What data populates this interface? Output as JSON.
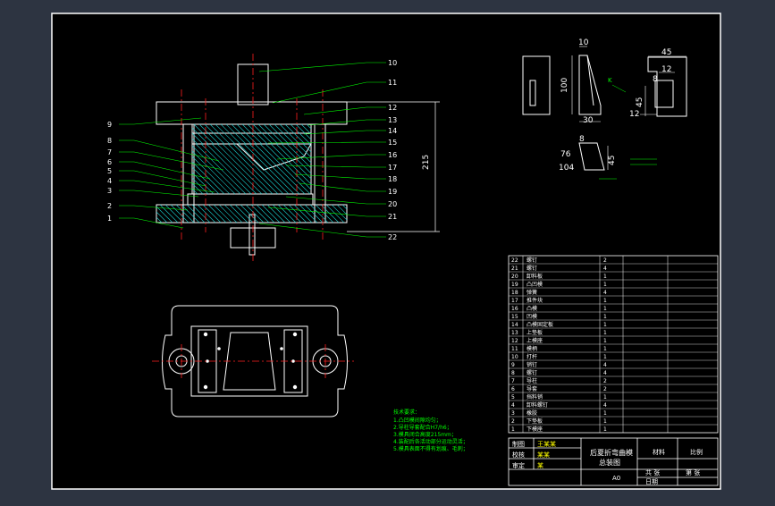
{
  "colors": {
    "background": "#2d3441",
    "drawing_bg": "#000000",
    "line": "#ffffff",
    "callout": "#00ff00",
    "centerline": "#ff2020",
    "hatch": "#19c8c8",
    "dimension": "#ffffff",
    "accent": "#ffff00"
  },
  "callouts": {
    "right": [
      "10",
      "11",
      "12",
      "13",
      "14",
      "15",
      "16",
      "17",
      "18",
      "19",
      "20",
      "21",
      "22"
    ],
    "left": [
      "9",
      "8",
      "7",
      "6",
      "5",
      "4",
      "3",
      "2",
      "1"
    ]
  },
  "dimensions": {
    "total_height": "215",
    "part_width_top": "10",
    "part_height": "100",
    "part_width_bottom": "30",
    "bracket_width": "45",
    "bracket_inner": "12",
    "bracket_bend": "8",
    "bracket_height": "45",
    "bracket_foot": "12",
    "small_angle": "76",
    "small_dim": "104",
    "small_height": "45",
    "small_width": "8",
    "marker_k": "K"
  },
  "bom": {
    "rows": [
      {
        "no": "22",
        "name": "螺钉",
        "qty": "2"
      },
      {
        "no": "21",
        "name": "螺钉",
        "qty": "4"
      },
      {
        "no": "20",
        "name": "卸料板",
        "qty": "1"
      },
      {
        "no": "19",
        "name": "凸凹模",
        "qty": "1"
      },
      {
        "no": "18",
        "name": "弹簧",
        "qty": "4"
      },
      {
        "no": "17",
        "name": "推件块",
        "qty": "1"
      },
      {
        "no": "16",
        "name": "凸模",
        "qty": "1"
      },
      {
        "no": "15",
        "name": "凹模",
        "qty": "1"
      },
      {
        "no": "14",
        "name": "凸模固定板",
        "qty": "1"
      },
      {
        "no": "13",
        "name": "上垫板",
        "qty": "1"
      },
      {
        "no": "12",
        "name": "上模座",
        "qty": "1"
      },
      {
        "no": "11",
        "name": "模柄",
        "qty": "1"
      },
      {
        "no": "10",
        "name": "打杆",
        "qty": "1"
      },
      {
        "no": "9",
        "name": "销钉",
        "qty": "4"
      },
      {
        "no": "8",
        "name": "螺钉",
        "qty": "4"
      },
      {
        "no": "7",
        "name": "导柱",
        "qty": "2"
      },
      {
        "no": "6",
        "name": "导套",
        "qty": "2"
      },
      {
        "no": "5",
        "name": "挡料销",
        "qty": "1"
      },
      {
        "no": "4",
        "name": "卸料螺钉",
        "qty": "4"
      },
      {
        "no": "3",
        "name": "橡胶",
        "qty": "1"
      },
      {
        "no": "2",
        "name": "下垫板",
        "qty": "1"
      },
      {
        "no": "1",
        "name": "下模座",
        "qty": "1"
      }
    ]
  },
  "title_block": {
    "title_line1": "后夏折弯曲模",
    "title_line2": "总装图",
    "scale": "A0",
    "rows": [
      {
        "label": "制图",
        "value": "王某某"
      },
      {
        "label": "校核",
        "value": "某某"
      },
      {
        "label": "审定",
        "value": "某"
      }
    ],
    "headers": [
      "材料",
      "比例"
    ],
    "sub_headers": [
      "共 张",
      "第 张"
    ],
    "date_label": "日期"
  },
  "tech_requirements": {
    "heading": "技术要求：",
    "lines": [
      "1.凸凹模间隙均匀；",
      "2.导柱导套配合H7/h6；",
      "3.模具闭合高度215mm；",
      "4.装配后各活动部分运动灵活；",
      "5.模具表面不得有划痕、毛刺；"
    ]
  }
}
